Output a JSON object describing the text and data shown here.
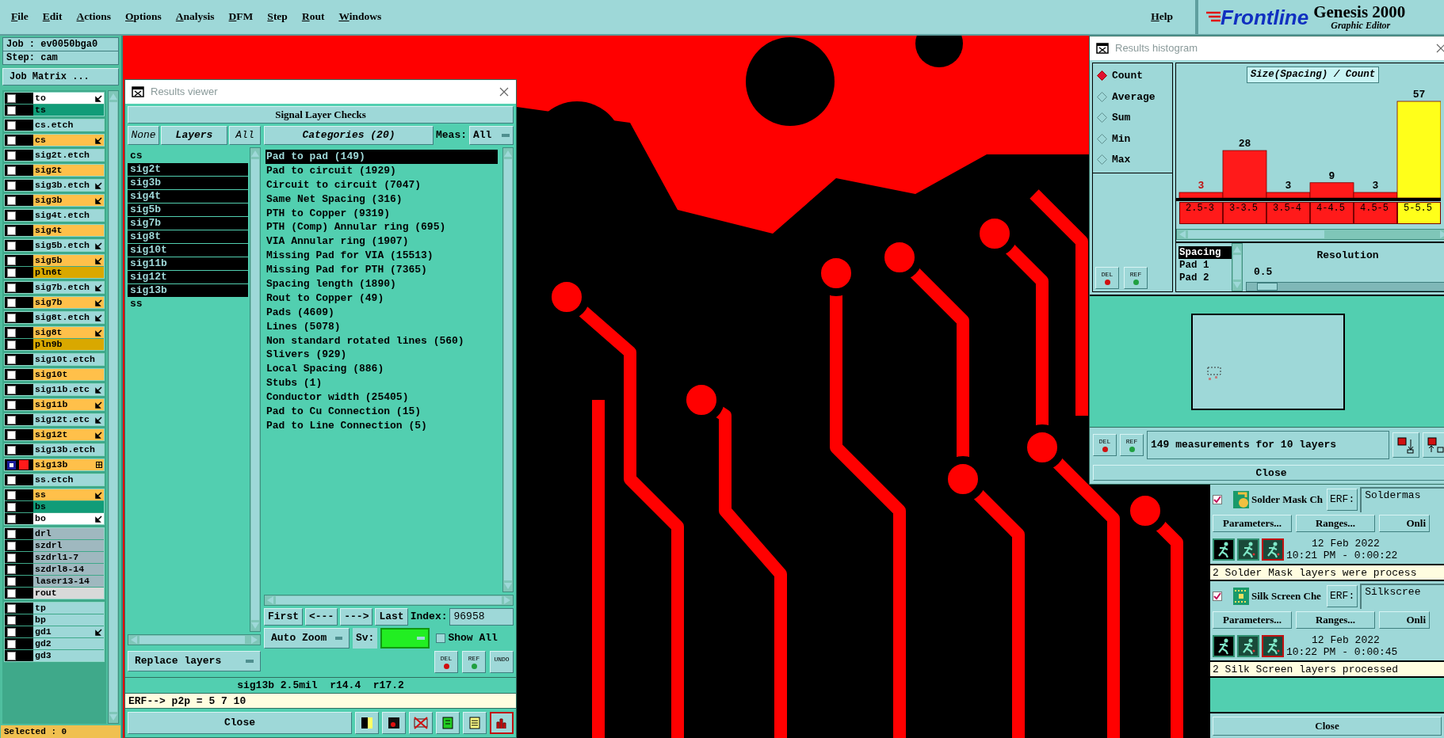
{
  "menu": [
    "File",
    "Edit",
    "Actions",
    "Options",
    "Analysis",
    "DFM",
    "Step",
    "Rout",
    "Windows"
  ],
  "help": "Help",
  "logo": {
    "brand": "Frontline",
    "product": "Genesis 2000",
    "subtitle": "Graphic Editor"
  },
  "job_panel": {
    "job": "Job : ev0050bga0",
    "step": "Step: cam",
    "matrix_button": "Job Matrix ...",
    "status": "Selected : 0",
    "layer_groups": [
      [
        {
          "name": "to",
          "color": "#ffffff",
          "kind": "arrow",
          "selected": false
        },
        {
          "name": "ts",
          "color": "#119c78",
          "kind": "plain",
          "selected": false
        }
      ],
      [
        {
          "name": "cs.etch",
          "color": "#9ed8d8",
          "kind": "plain",
          "selected": false
        }
      ],
      [
        {
          "name": "cs",
          "color": "#ffc04a",
          "kind": "arrow",
          "selected": false
        }
      ],
      [
        {
          "name": "sig2t.etch",
          "color": "#9ed8d8",
          "kind": "plain",
          "selected": false
        }
      ],
      [
        {
          "name": "sig2t",
          "color": "#ffc04a",
          "kind": "plain",
          "selected": false
        }
      ],
      [
        {
          "name": "sig3b.etch",
          "color": "#9ed8d8",
          "kind": "arrow",
          "selected": false
        }
      ],
      [
        {
          "name": "sig3b",
          "color": "#ffc04a",
          "kind": "arrow",
          "selected": false
        }
      ],
      [
        {
          "name": "sig4t.etch",
          "color": "#9ed8d8",
          "kind": "plain",
          "selected": false
        }
      ],
      [
        {
          "name": "sig4t",
          "color": "#ffc04a",
          "kind": "plain",
          "selected": false
        }
      ],
      [
        {
          "name": "sig5b.etch",
          "color": "#9ed8d8",
          "kind": "arrow",
          "selected": false
        }
      ],
      [
        {
          "name": "sig5b",
          "color": "#ffc04a",
          "kind": "arrow",
          "selected": false
        },
        {
          "name": "pln6t",
          "color": "#d9a800",
          "kind": "plain",
          "selected": false
        }
      ],
      [
        {
          "name": "sig7b.etch",
          "color": "#9ed8d8",
          "kind": "arrow",
          "selected": false
        }
      ],
      [
        {
          "name": "sig7b",
          "color": "#ffc04a",
          "kind": "arrow",
          "selected": false
        }
      ],
      [
        {
          "name": "sig8t.etch",
          "color": "#9ed8d8",
          "kind": "arrow",
          "selected": false
        }
      ],
      [
        {
          "name": "sig8t",
          "color": "#ffc04a",
          "kind": "arrow",
          "selected": false
        },
        {
          "name": "pln9b",
          "color": "#d9a800",
          "kind": "plain",
          "selected": false
        }
      ],
      [
        {
          "name": "sig10t.etch",
          "color": "#9ed8d8",
          "kind": "plain",
          "selected": false
        }
      ],
      [
        {
          "name": "sig10t",
          "color": "#ffc04a",
          "kind": "plain",
          "selected": false
        }
      ],
      [
        {
          "name": "sig11b.etc",
          "color": "#9ed8d8",
          "kind": "arrow",
          "selected": false
        }
      ],
      [
        {
          "name": "sig11b",
          "color": "#ffc04a",
          "kind": "arrow",
          "selected": false
        }
      ],
      [
        {
          "name": "sig12t.etc",
          "color": "#9ed8d8",
          "kind": "arrow",
          "selected": false
        }
      ],
      [
        {
          "name": "sig12t",
          "color": "#ffc04a",
          "kind": "arrow",
          "selected": false
        }
      ],
      [
        {
          "name": "sig13b.etch",
          "color": "#9ed8d8",
          "kind": "plain",
          "selected": false
        }
      ],
      [
        {
          "name": "sig13b",
          "color": "#ffc04a",
          "kind": "grid",
          "selected": true
        }
      ],
      [
        {
          "name": "ss.etch",
          "color": "#9ed8d8",
          "kind": "plain",
          "selected": false
        }
      ],
      [
        {
          "name": "ss",
          "color": "#ffc04a",
          "kind": "arrow",
          "selected": false
        },
        {
          "name": "bs",
          "color": "#119c78",
          "kind": "plain",
          "selected": false
        },
        {
          "name": "bo",
          "color": "#ffffff",
          "kind": "arrow",
          "selected": false
        }
      ],
      [
        {
          "name": "drl",
          "color": "#9fb8bf",
          "kind": "plain",
          "selected": false
        },
        {
          "name": "szdrl",
          "color": "#9fb8bf",
          "kind": "plain",
          "selected": false
        },
        {
          "name": "szdrl1-7",
          "color": "#9fb8bf",
          "kind": "plain",
          "selected": false
        },
        {
          "name": "szdrl8-14",
          "color": "#9fb8bf",
          "kind": "plain",
          "selected": false
        },
        {
          "name": "laser13-14",
          "color": "#9fb8bf",
          "kind": "plain",
          "selected": false
        },
        {
          "name": "rout",
          "color": "#d9d9d9",
          "kind": "plain",
          "selected": false
        }
      ],
      [
        {
          "name": "tp",
          "color": "#9ed8d8",
          "kind": "plain",
          "selected": false
        },
        {
          "name": "bp",
          "color": "#9ed8d8",
          "kind": "plain",
          "selected": false
        },
        {
          "name": "gd1",
          "color": "#9ed8d8",
          "kind": "arrow",
          "selected": false
        },
        {
          "name": "gd2",
          "color": "#9ed8d8",
          "kind": "plain",
          "selected": false
        },
        {
          "name": "gd3",
          "color": "#9ed8d8",
          "kind": "plain",
          "selected": false
        }
      ]
    ]
  },
  "results_viewer": {
    "title": "Results viewer",
    "heading": "Signal Layer Checks",
    "layer_buttons": [
      "None",
      "Layers",
      "All"
    ],
    "layers": [
      {
        "name": "cs",
        "selected": false
      },
      {
        "name": "sig2t",
        "selected": true
      },
      {
        "name": "sig3b",
        "selected": true
      },
      {
        "name": "sig4t",
        "selected": true
      },
      {
        "name": "sig5b",
        "selected": true
      },
      {
        "name": "sig7b",
        "selected": true
      },
      {
        "name": "sig8t",
        "selected": true
      },
      {
        "name": "sig10t",
        "selected": true
      },
      {
        "name": "sig11b",
        "selected": true
      },
      {
        "name": "sig12t",
        "selected": true
      },
      {
        "name": "sig13b",
        "selected": true
      },
      {
        "name": "ss",
        "selected": false
      }
    ],
    "categories_button": "Categories (20)",
    "meas_label": "Meas:",
    "meas_value": "All",
    "categories": [
      {
        "name": "Pad to pad (149)",
        "selected": true
      },
      {
        "name": "Pad to circuit (1929)",
        "selected": false
      },
      {
        "name": "Circuit to circuit (7047)",
        "selected": false
      },
      {
        "name": "Same Net Spacing (316)",
        "selected": false
      },
      {
        "name": "PTH to Copper (9319)",
        "selected": false
      },
      {
        "name": "PTH (Comp) Annular ring (695)",
        "selected": false
      },
      {
        "name": "VIA Annular ring (1907)",
        "selected": false
      },
      {
        "name": "Missing Pad for VIA (15513)",
        "selected": false
      },
      {
        "name": "Missing Pad for PTH (7365)",
        "selected": false
      },
      {
        "name": "Spacing length (1890)",
        "selected": false
      },
      {
        "name": "Rout to Copper (49)",
        "selected": false
      },
      {
        "name": "Pads (4609)",
        "selected": false
      },
      {
        "name": "Lines (5078)",
        "selected": false
      },
      {
        "name": "Non standard rotated lines (560)",
        "selected": false
      },
      {
        "name": "Slivers (929)",
        "selected": false
      },
      {
        "name": "Local Spacing (886)",
        "selected": false
      },
      {
        "name": "Stubs (1)",
        "selected": false
      },
      {
        "name": "Conductor width (25405)",
        "selected": false
      },
      {
        "name": "Pad to Cu Connection (15)",
        "selected": false
      },
      {
        "name": "Pad to Line Connection (5)",
        "selected": false
      }
    ],
    "nav_buttons": [
      "First",
      "<---",
      "--->",
      "Last"
    ],
    "index_label": "Index:",
    "index_value": "96958",
    "zoom_mode": "Auto Zoom",
    "sv_label": "Sv:",
    "show_all": {
      "label": "Show All",
      "checked": false
    },
    "tool_buttons": [
      "DEL",
      "REF",
      "UNDO"
    ],
    "replace_mode": "Replace layers",
    "status": "sig13b 2.5mil  r14.4  r17.2",
    "erf_line": "ERF--> p2p = 5 7 10",
    "close": "Close"
  },
  "histogram": {
    "title": "Results histogram",
    "modes": [
      {
        "label": "Count",
        "selected": true
      },
      {
        "label": "Average",
        "selected": false
      },
      {
        "label": "Sum",
        "selected": false
      },
      {
        "label": "Min",
        "selected": false
      },
      {
        "label": "Max",
        "selected": false
      }
    ],
    "chart_data": {
      "type": "bar",
      "title": "Size(Spacing) / Count",
      "categories": [
        "2.5-3",
        "3-3.5",
        "3.5-4",
        "4-4.5",
        "4.5-5",
        "5-5.5"
      ],
      "series": [
        {
          "color": "#ff1a1a",
          "values": [
            3,
            28,
            3,
            9,
            3,
            null
          ]
        },
        {
          "color": "#ffff1a",
          "values": [
            null,
            null,
            null,
            null,
            null,
            57
          ]
        }
      ],
      "data_labels": true
    },
    "buttons": [
      "DEL",
      "REF"
    ],
    "fields": [
      {
        "name": "Spacing",
        "selected": true
      },
      {
        "name": "Pad 1",
        "selected": false
      },
      {
        "name": "Pad 2",
        "selected": false
      }
    ],
    "resolution": {
      "label": "Resolution",
      "value": "0.5",
      "level": 0.05
    },
    "summary_buttons": [
      "DEL",
      "REF"
    ],
    "summary": "149 measurements for 10 layers",
    "close": "Close"
  },
  "checks_panel": {
    "checks": [
      {
        "name": "Solder Mask Ch",
        "kind": "mask",
        "checked": true,
        "erf_label": "ERF:",
        "erf_value": "Soldermas",
        "buttons": [
          "Parameters...",
          "Ranges...",
          "Onli"
        ],
        "date": "12 Feb 2022",
        "time": "10:21 PM - 0:00:22",
        "message": "2 Solder Mask layers were process"
      },
      {
        "name": "Silk Screen Che",
        "kind": "silk",
        "checked": true,
        "erf_label": "ERF:",
        "erf_value": "Silkscree",
        "buttons": [
          "Parameters...",
          "Ranges...",
          "Onli"
        ],
        "date": "12 Feb 2022",
        "time": "10:22 PM - 0:00:45",
        "message": "2 Silk Screen layers processed"
      }
    ],
    "close": "Close"
  }
}
